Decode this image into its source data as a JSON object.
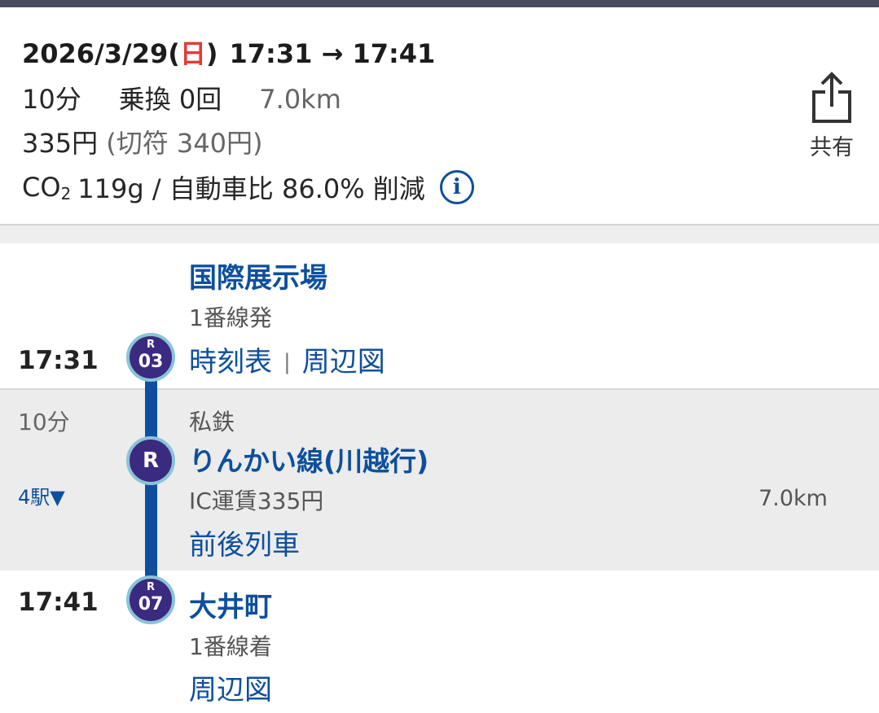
{
  "summary": {
    "date": "2026/3/29(",
    "weekday": "日",
    "date_close": ")",
    "time_range": "17:31 → 17:41",
    "duration": "10分",
    "transfers": "乗換 0回",
    "distance": "7.0km",
    "fare": "335円",
    "ticket_fare": "(切符 340円)",
    "co2_prefix": "CO",
    "co2_sub": "2",
    "co2_text": "119g / 自動車比 86.0% 削減",
    "info_icon": "info-icon",
    "colors": {
      "weekday_red": "#e53935",
      "link_blue": "#0d4f9e",
      "badge_purple": "#3a2a80"
    }
  },
  "share": {
    "icon": "share-icon",
    "label": "共有"
  },
  "departure": {
    "time": "17:31",
    "station": "国際展示場",
    "platform": "1番線発",
    "badge_line": "R",
    "badge_number": "03",
    "links": [
      "時刻表",
      "周辺図"
    ],
    "separator": "|"
  },
  "ride": {
    "duration": "10分",
    "stations_toggle": "4駅▼",
    "type": "私鉄",
    "line_name": "りんかい線(川越行)",
    "badge_line": "R",
    "fare": "IC運賃335円",
    "distance": "7.0km",
    "prev_next_link": "前後列車"
  },
  "arrival": {
    "time": "17:41",
    "station": "大井町",
    "platform": "1番線着",
    "badge_line": "R",
    "badge_number": "07",
    "link": "周辺図"
  }
}
